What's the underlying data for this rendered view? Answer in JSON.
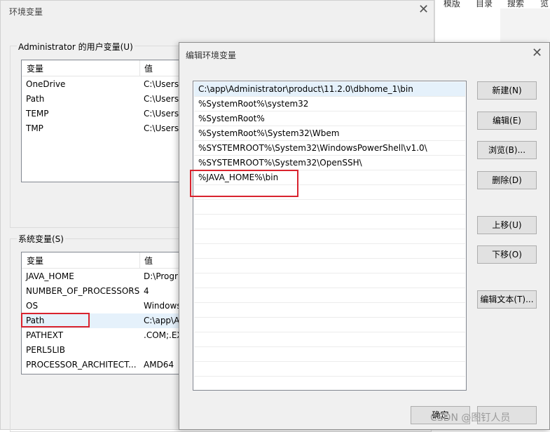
{
  "background_app": {
    "tabs": [
      "模版",
      "目录",
      "搜索",
      "览"
    ]
  },
  "back_dialog": {
    "title": "环境变量",
    "user_group": {
      "label": "Administrator 的用户变量(U)",
      "headers": [
        "变量",
        "值"
      ],
      "rows": [
        {
          "name": "OneDrive",
          "value": "C:\\Users\\"
        },
        {
          "name": "Path",
          "value": "C:\\Users\\"
        },
        {
          "name": "TEMP",
          "value": "C:\\Users\\"
        },
        {
          "name": "TMP",
          "value": "C:\\Users\\"
        }
      ]
    },
    "system_group": {
      "label": "系统变量(S)",
      "headers": [
        "变量",
        "值"
      ],
      "rows": [
        {
          "name": "JAVA_HOME",
          "value": "D:\\Progr"
        },
        {
          "name": "NUMBER_OF_PROCESSORS",
          "value": "4"
        },
        {
          "name": "OS",
          "value": "Windows"
        },
        {
          "name": "Path",
          "value": "C:\\app\\A"
        },
        {
          "name": "PATHEXT",
          "value": ".COM;.EX"
        },
        {
          "name": "PERL5LIB",
          "value": ""
        },
        {
          "name": "PROCESSOR_ARCHITECT...",
          "value": "AMD64"
        }
      ]
    }
  },
  "edit_dialog": {
    "title": "编辑环境变量",
    "entries": [
      "C:\\app\\Administrator\\product\\11.2.0\\dbhome_1\\bin",
      "%SystemRoot%\\system32",
      "%SystemRoot%",
      "%SystemRoot%\\System32\\Wbem",
      "%SYSTEMROOT%\\System32\\WindowsPowerShell\\v1.0\\",
      "%SYSTEMROOT%\\System32\\OpenSSH\\",
      "%JAVA_HOME%\\bin"
    ],
    "buttons": {
      "new": "新建(N)",
      "edit": "编辑(E)",
      "browse": "浏览(B)...",
      "delete": "删除(D)",
      "move_up": "上移(U)",
      "move_down": "下移(O)",
      "edit_text": "编辑文本(T)...",
      "ok": "确定"
    }
  },
  "watermark": "CSDN @图钉人员",
  "close_glyph": "✕"
}
